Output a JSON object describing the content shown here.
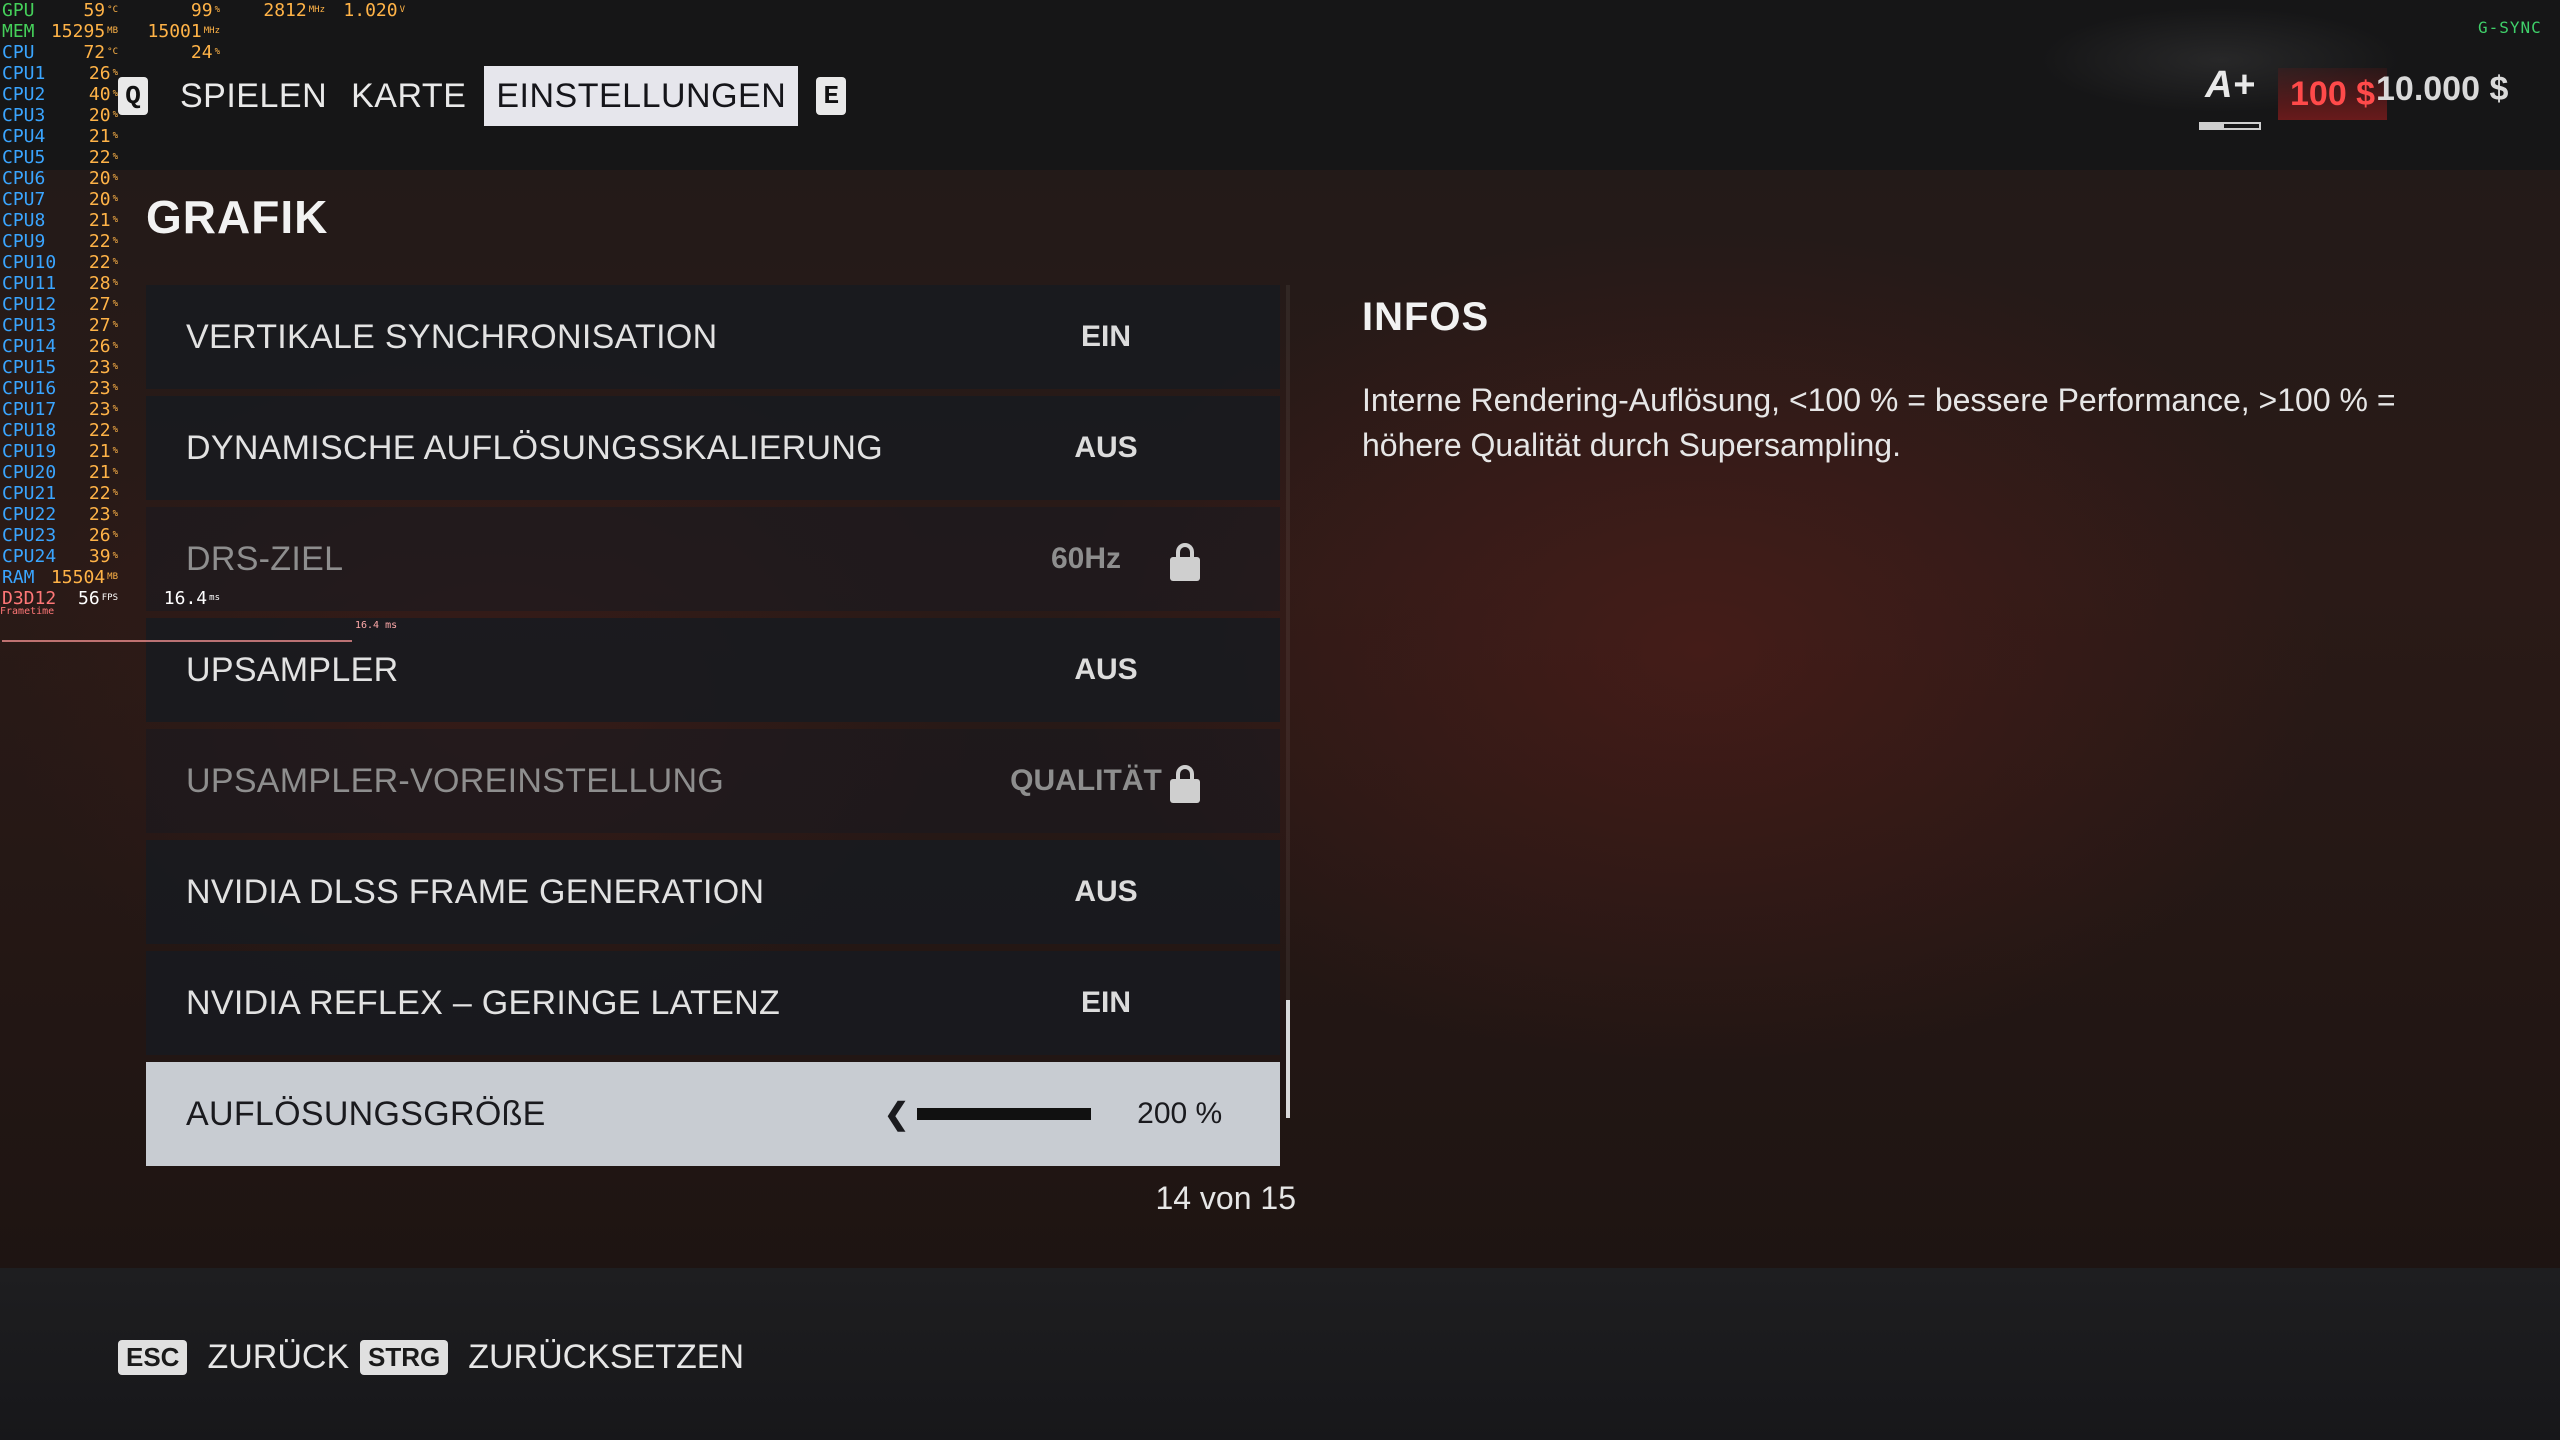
{
  "nav": {
    "prev_key": "Q",
    "next_key": "E",
    "tabs": [
      {
        "label": "SPIELEN",
        "active": false
      },
      {
        "label": "KARTE",
        "active": false
      },
      {
        "label": "EINSTELLUNGEN",
        "active": true
      }
    ]
  },
  "player": {
    "rating_icon": "A+",
    "rating_progress": 0.4,
    "money_change": "100 $",
    "money_total": "10.000 $"
  },
  "gsync": "G-SYNC",
  "section_title": "GRAFIK",
  "settings": [
    {
      "label": "VERTIKALE SYNCHRONISATION",
      "value": "EIN",
      "locked": false
    },
    {
      "label": "DYNAMISCHE AUFLÖSUNGSSKALIERUNG",
      "value": "AUS",
      "locked": false
    },
    {
      "label": "DRS-ZIEL",
      "value": "60Hz",
      "locked": true
    },
    {
      "label": "UPSAMPLER",
      "value": "AUS",
      "locked": false
    },
    {
      "label": "UPSAMPLER-VOREINSTELLUNG",
      "value": "QUALITÄT",
      "locked": true
    },
    {
      "label": "NVIDIA DLSS FRAME GENERATION",
      "value": "AUS",
      "locked": false
    },
    {
      "label": "NVIDIA REFLEX – GERINGE LATENZ",
      "value": "EIN",
      "locked": false
    },
    {
      "label": "AUFLÖSUNGSGRÖßE",
      "value": "200 %",
      "slider_level": 1.0,
      "selected": true
    }
  ],
  "counter": "14 von 15",
  "info": {
    "title": "INFOS",
    "text": "Interne Rendering-Auflösung, <100 % = bessere Performance, >100 % = höhere Qualität durch Supersampling."
  },
  "footer": {
    "back_key": "ESC",
    "back_label": "ZURÜCK",
    "reset_key": "STRG",
    "reset_label": "ZURÜCKSETZEN"
  },
  "osd": {
    "rows": [
      {
        "name": "GPU",
        "a": "59",
        "au": "°C",
        "b": "99",
        "bu": "%",
        "c": "2812",
        "cu": "MHz",
        "d": "1.020",
        "du": "V"
      },
      {
        "name": "MEM",
        "a": "15295",
        "au": "MB",
        "b": "15001",
        "bu": "MHz"
      },
      {
        "name": "CPU",
        "a": "72",
        "au": "°C",
        "b": "24",
        "bu": "%"
      },
      {
        "name": "CPU1",
        "a": "26",
        "au": "%"
      },
      {
        "name": "CPU2",
        "a": "40",
        "au": "%"
      },
      {
        "name": "CPU3",
        "a": "20",
        "au": "%"
      },
      {
        "name": "CPU4",
        "a": "21",
        "au": "%"
      },
      {
        "name": "CPU5",
        "a": "22",
        "au": "%"
      },
      {
        "name": "CPU6",
        "a": "20",
        "au": "%"
      },
      {
        "name": "CPU7",
        "a": "20",
        "au": "%"
      },
      {
        "name": "CPU8",
        "a": "21",
        "au": "%"
      },
      {
        "name": "CPU9",
        "a": "22",
        "au": "%"
      },
      {
        "name": "CPU10",
        "a": "22",
        "au": "%"
      },
      {
        "name": "CPU11",
        "a": "28",
        "au": "%"
      },
      {
        "name": "CPU12",
        "a": "27",
        "au": "%"
      },
      {
        "name": "CPU13",
        "a": "27",
        "au": "%"
      },
      {
        "name": "CPU14",
        "a": "26",
        "au": "%"
      },
      {
        "name": "CPU15",
        "a": "23",
        "au": "%"
      },
      {
        "name": "CPU16",
        "a": "23",
        "au": "%"
      },
      {
        "name": "CPU17",
        "a": "23",
        "au": "%"
      },
      {
        "name": "CPU18",
        "a": "22",
        "au": "%"
      },
      {
        "name": "CPU19",
        "a": "21",
        "au": "%"
      },
      {
        "name": "CPU20",
        "a": "21",
        "au": "%"
      },
      {
        "name": "CPU21",
        "a": "22",
        "au": "%"
      },
      {
        "name": "CPU22",
        "a": "23",
        "au": "%"
      },
      {
        "name": "CPU23",
        "a": "26",
        "au": "%"
      },
      {
        "name": "CPU24",
        "a": "39",
        "au": "%"
      },
      {
        "name": "RAM",
        "a": "15504",
        "au": "MB"
      },
      {
        "name": "D3D12",
        "a": "56",
        "au": "FPS",
        "b": "16.4",
        "bu": "ms"
      }
    ],
    "frametime_label": "Frametime",
    "frametime_ms": "16.4 ms"
  }
}
